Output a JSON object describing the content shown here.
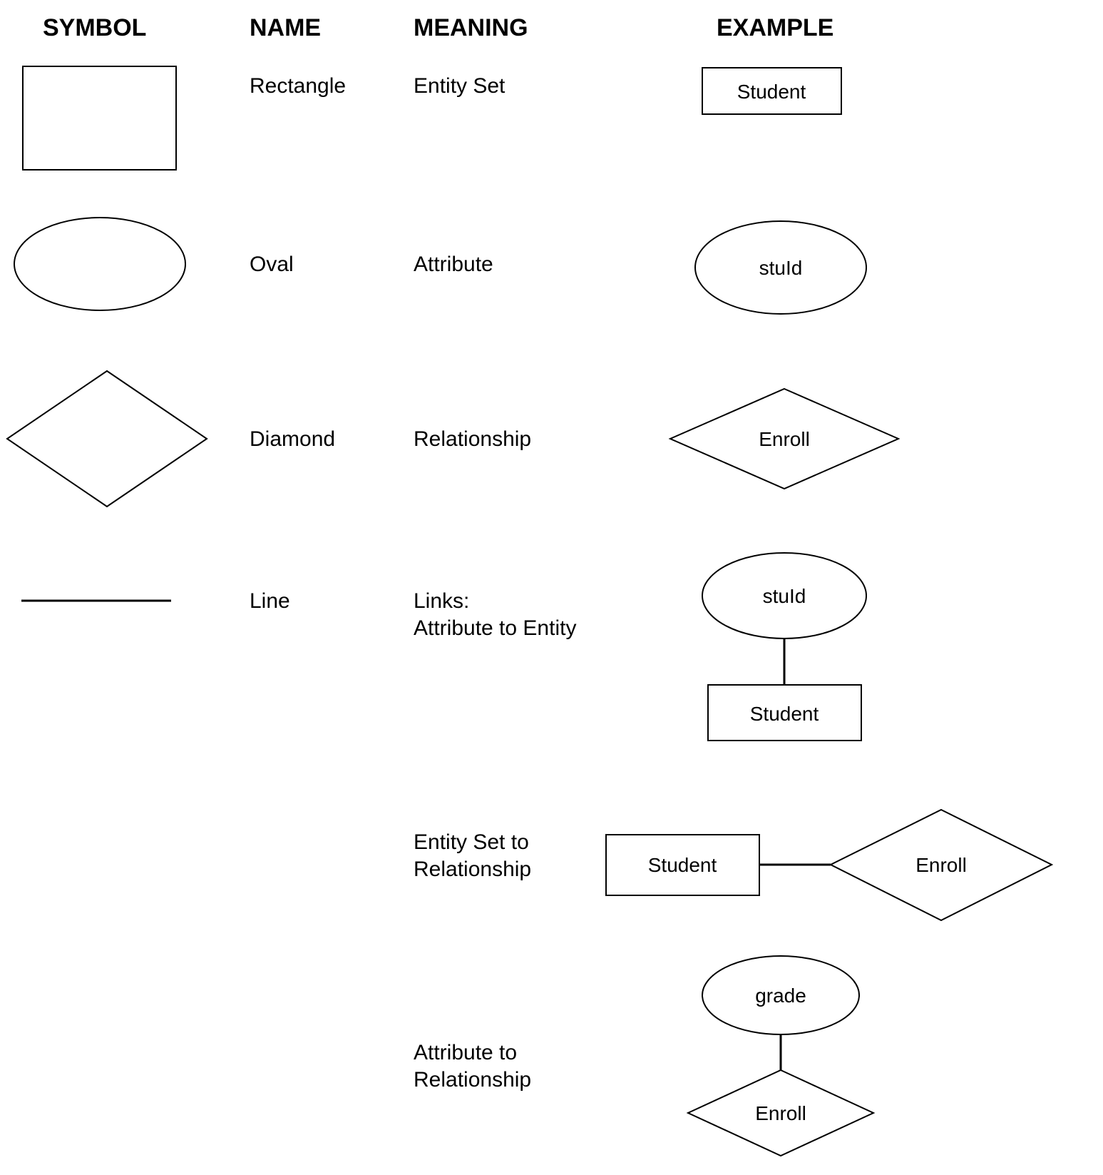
{
  "headers": {
    "symbol": "SYMBOL",
    "name": "NAME",
    "meaning": "MEANING",
    "example": "EXAMPLE"
  },
  "rows": [
    {
      "name": "Rectangle",
      "meaning": "Entity Set",
      "example_label": "Student"
    },
    {
      "name": "Oval",
      "meaning": "Attribute",
      "example_label": "stuId"
    },
    {
      "name": "Diamond",
      "meaning": "Relationship",
      "example_label": "Enroll"
    },
    {
      "name": "Line",
      "meaning_line1": "Links:",
      "meaning_line2": "Attribute to Entity",
      "example_oval": "stuId",
      "example_rect": "Student"
    },
    {
      "meaning_line1": "Entity Set to",
      "meaning_line2": "Relationship",
      "example_rect": "Student",
      "example_diamond": "Enroll"
    },
    {
      "meaning_line1": "Attribute to",
      "meaning_line2": "Relationship",
      "example_oval": "grade",
      "example_diamond": "Enroll"
    }
  ]
}
